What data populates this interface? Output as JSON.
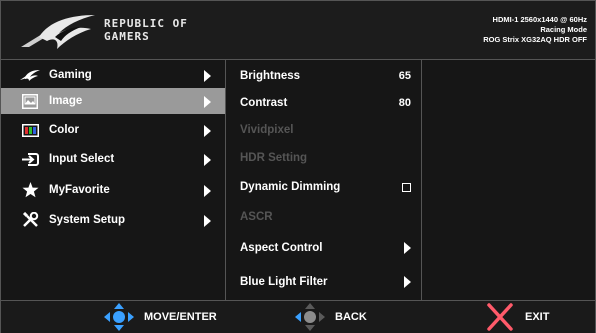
{
  "header": {
    "brand_line1": "REPUBLIC OF",
    "brand_line2": "GAMERS",
    "status_line1": "HDMI-1 2560x1440 @ 60Hz",
    "status_line2": "Racing Mode",
    "status_line3": "ROG Strix XG32AQ HDR OFF"
  },
  "menu": {
    "items": [
      {
        "label": "Gaming",
        "icon": "rog-eye-icon"
      },
      {
        "label": "Image",
        "icon": "image-icon",
        "selected": true
      },
      {
        "label": "Color",
        "icon": "color-icon"
      },
      {
        "label": "Input Select",
        "icon": "input-select-icon"
      },
      {
        "label": "MyFavorite",
        "icon": "star-icon"
      },
      {
        "label": "System Setup",
        "icon": "wrench-screwdriver-icon"
      }
    ]
  },
  "submenu": {
    "items": [
      {
        "label": "Brightness",
        "value": "65"
      },
      {
        "label": "Contrast",
        "value": "80"
      },
      {
        "label": "Vividpixel",
        "disabled": true
      },
      {
        "label": "HDR Setting",
        "disabled": true
      },
      {
        "label": "Dynamic Dimming",
        "checkbox": false
      },
      {
        "label": "ASCR",
        "disabled": true
      },
      {
        "label": "Aspect Control",
        "arrow": true
      },
      {
        "label": "Blue Light Filter",
        "arrow": true
      }
    ]
  },
  "footer": {
    "move_enter": "MOVE/ENTER",
    "back": "BACK",
    "exit": "EXIT"
  },
  "colors": {
    "accent_blue": "#3aa0ff",
    "exit_red": "#ff5a6a",
    "selected_bg": "#9a9a9a"
  }
}
